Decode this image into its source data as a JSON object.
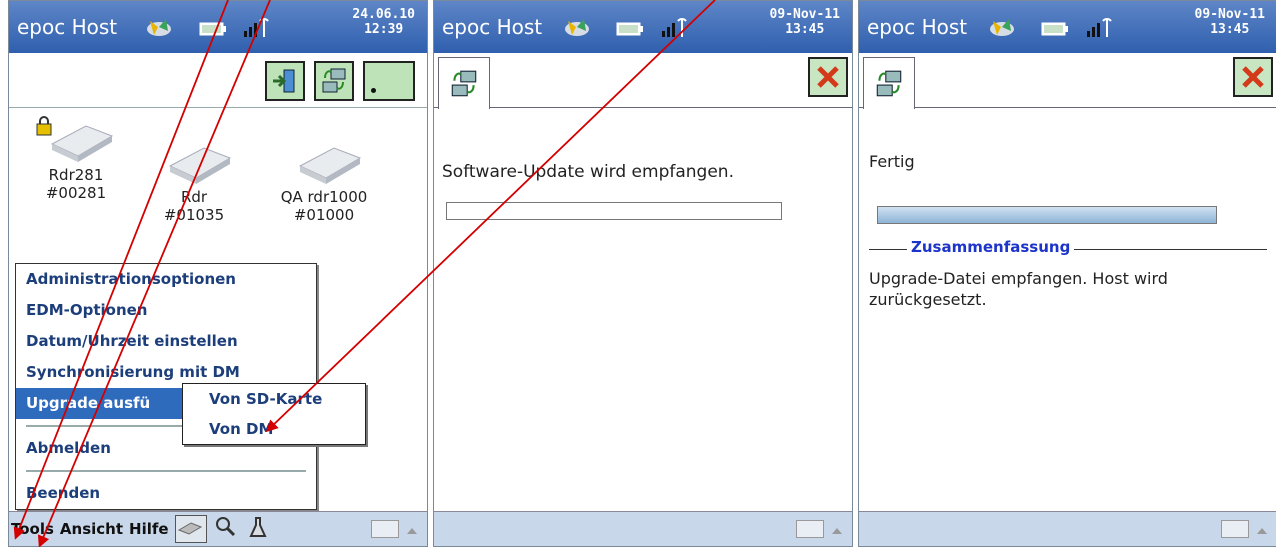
{
  "screens": [
    {
      "title": "epoc Host",
      "date": "24.06.10",
      "time": "12:39",
      "devices": [
        {
          "name": "Rdr281",
          "id": "#00281",
          "locked": true
        },
        {
          "name": "Rdr",
          "id": "#01035",
          "locked": false
        },
        {
          "name": "QA rdr1000",
          "id": "#01000",
          "locked": false
        }
      ],
      "menu": {
        "items": [
          "Administrationsoptionen",
          "EDM-Optionen",
          "Datum/Uhrzeit einstellen",
          "Synchronisierung mit DM",
          "Upgrade ausfü"
        ],
        "logout": "Abmelden",
        "exit": "Beenden",
        "selected_index": 4
      },
      "submenu": [
        "Von SD-Karte",
        "Von DM"
      ],
      "menubar": [
        "Tools",
        "Ansicht",
        "Hilfe"
      ]
    },
    {
      "title": "epoc Host",
      "date": "09-Nov-11",
      "time": "13:45",
      "message": "Software-Update wird empfangen.",
      "progress": 0
    },
    {
      "title": "epoc Host",
      "date": "09-Nov-11",
      "time": "13:45",
      "message": "Fertig",
      "progress": 1,
      "summary_label": "Zusammenfassung",
      "summary_text": "Upgrade-Datei empfangen. Host wird zurückgesetzt."
    }
  ],
  "colors": {
    "titlebar": "#2f5fae",
    "menu_text": "#1c3e7a",
    "selection": "#2f6bbd",
    "summary_label": "#1c34c9",
    "annotation_arrow": "#d40000"
  }
}
